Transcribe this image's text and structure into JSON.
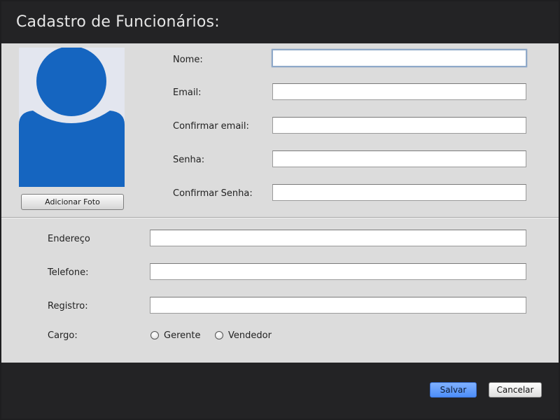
{
  "window": {
    "title": "Cadastro de Funcionários:"
  },
  "photo": {
    "add_button": "Adicionar Foto"
  },
  "account": {
    "name_label": "Nome:",
    "name_value": "",
    "email_label": "Email:",
    "email_value": "",
    "confirm_email_label": "Confirmar email:",
    "confirm_email_value": "",
    "password_label": "Senha:",
    "password_value": "",
    "confirm_password_label": "Confirmar Senha:",
    "confirm_password_value": ""
  },
  "details": {
    "address_label": "Endereço",
    "address_value": "",
    "phone_label": "Telefone:",
    "phone_value": "",
    "registry_label": "Registro:",
    "registry_value": "",
    "role_label": "Cargo:",
    "role_options": [
      "Gerente",
      "Vendedor"
    ],
    "role_selected": null
  },
  "footer": {
    "save_label": "Salvar",
    "cancel_label": "Cancelar"
  },
  "colors": {
    "header_bg": "#232325",
    "panel_bg": "#dcdcdc",
    "avatar_blue": "#1565c0",
    "avatar_bg": "#e3e6ef",
    "primary_button": "#5b95fb"
  },
  "icons": {
    "avatar": "user-silhouette-icon"
  }
}
